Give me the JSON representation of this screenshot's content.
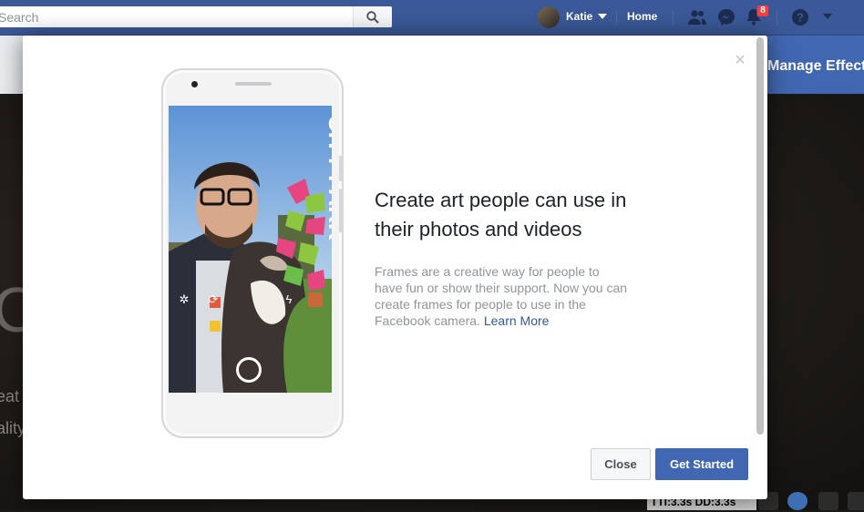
{
  "topbar": {
    "search_placeholder": "Search",
    "user_name": "Katie",
    "home_label": "Home",
    "notification_count": "8"
  },
  "page": {
    "manage_effects_label": "Manage Effects",
    "bg_text_1": "eat",
    "bg_text_2": "ality",
    "bg_big": "Ca"
  },
  "modal": {
    "headline": "Create art people can use in their photos and videos",
    "body": "Frames are a creative way for people to have fun or show their support. Now you can create frames for people to use in the Facebook camera.",
    "learn_more": "Learn More",
    "close_button": "Close",
    "get_started_button": "Get Started",
    "frame_text": "CITY PARK"
  },
  "status": {
    "perf_text": "TTI:3.3s DD:3.3s"
  },
  "colors": {
    "brand": "#3b5998",
    "primary_button": "#4267b2",
    "link": "#365899",
    "badge": "#fa3e3e"
  }
}
